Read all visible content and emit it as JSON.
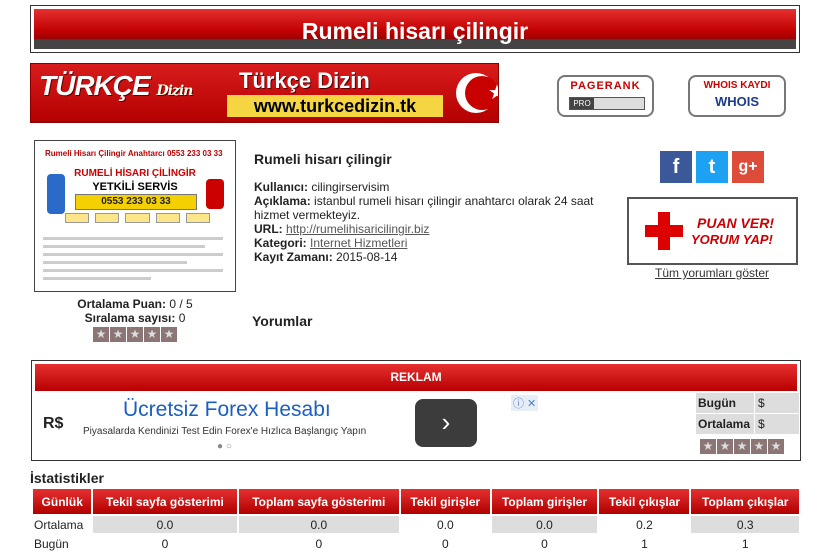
{
  "page_title": "Rumeli hisarı çilingir",
  "banner": {
    "logo": "TÜRKÇE",
    "logo_sub": "Dizin",
    "title": "Türkçe Dizin",
    "url": "www.turkcedizin.tk"
  },
  "pagerank": {
    "label": "PAGERANK",
    "pro": "PRO"
  },
  "whois": {
    "label": "WHOIS KAYDI",
    "text": "WHOIS"
  },
  "thumbnail": {
    "header": "Rumeli Hisarı Çilingir Anahtarcı 0553 233 03 33",
    "line1": "RUMELİ HİSARI ÇİLİNGİR",
    "line2": "YETKİLİ SERVİS",
    "phone": "0553 233 03 33"
  },
  "listing": {
    "title": "Rumeli hisarı çilingir",
    "user_label": "Kullanıcı:",
    "user": "cilingirservisim",
    "desc_label": "Açıklama:",
    "desc": "istanbul rumeli hisarı çilingir anahtarcı olarak 24 saat hizmet vermekteyiz.",
    "url_label": "URL:",
    "url": "http://rumelihisaricilingir.biz",
    "cat_label": "Kategori:",
    "category": "Internet Hizmetleri",
    "date_label": "Kayıt Zamanı:",
    "date": "2015-08-14"
  },
  "rating": {
    "avg_label": "Ortalama Puan:",
    "avg": "0 / 5",
    "count_label": "Sıralama sayısı:",
    "count": "0"
  },
  "social": {
    "facebook": "f",
    "twitter": "t",
    "google": "g+"
  },
  "puan_ver": {
    "line1": "PUAN VER!",
    "line2": "YORUM YAP!"
  },
  "all_reviews_link": "Tüm yorumları göster",
  "comments_title": "Yorumlar",
  "reklam": {
    "header": "REKLAM",
    "ad_logo": "R$",
    "ad_headline": "Ücretsiz Forex Hesabı",
    "ad_sub": "Piyasalarda Kendinizi Test Edin Forex'e Hızlıca Başlangıç Yapın",
    "ad_button": "›",
    "ad_dots": "● ○",
    "ad_choices": "ⓘ ✕",
    "side": [
      {
        "k": "Bugün",
        "v": "$"
      },
      {
        "k": "Ortalama",
        "v": "$"
      }
    ]
  },
  "stats": {
    "title": "İstatistikler",
    "headers": [
      "Günlük",
      "Tekil sayfa gösterimi",
      "Toplam sayfa gösterimi",
      "Tekil girişler",
      "Toplam girişler",
      "Tekil çıkışlar",
      "Toplam çıkışlar"
    ],
    "rows": [
      [
        "Ortalama",
        "0.0",
        "0.0",
        "0.0",
        "0.0",
        "0.2",
        "0.3"
      ],
      [
        "Bugün",
        "0",
        "0",
        "0",
        "0",
        "1",
        "1"
      ]
    ]
  },
  "colors": {
    "primary_red": "#c10000",
    "facebook": "#3b5998",
    "twitter": "#1da1f2",
    "google": "#dd4b39"
  }
}
